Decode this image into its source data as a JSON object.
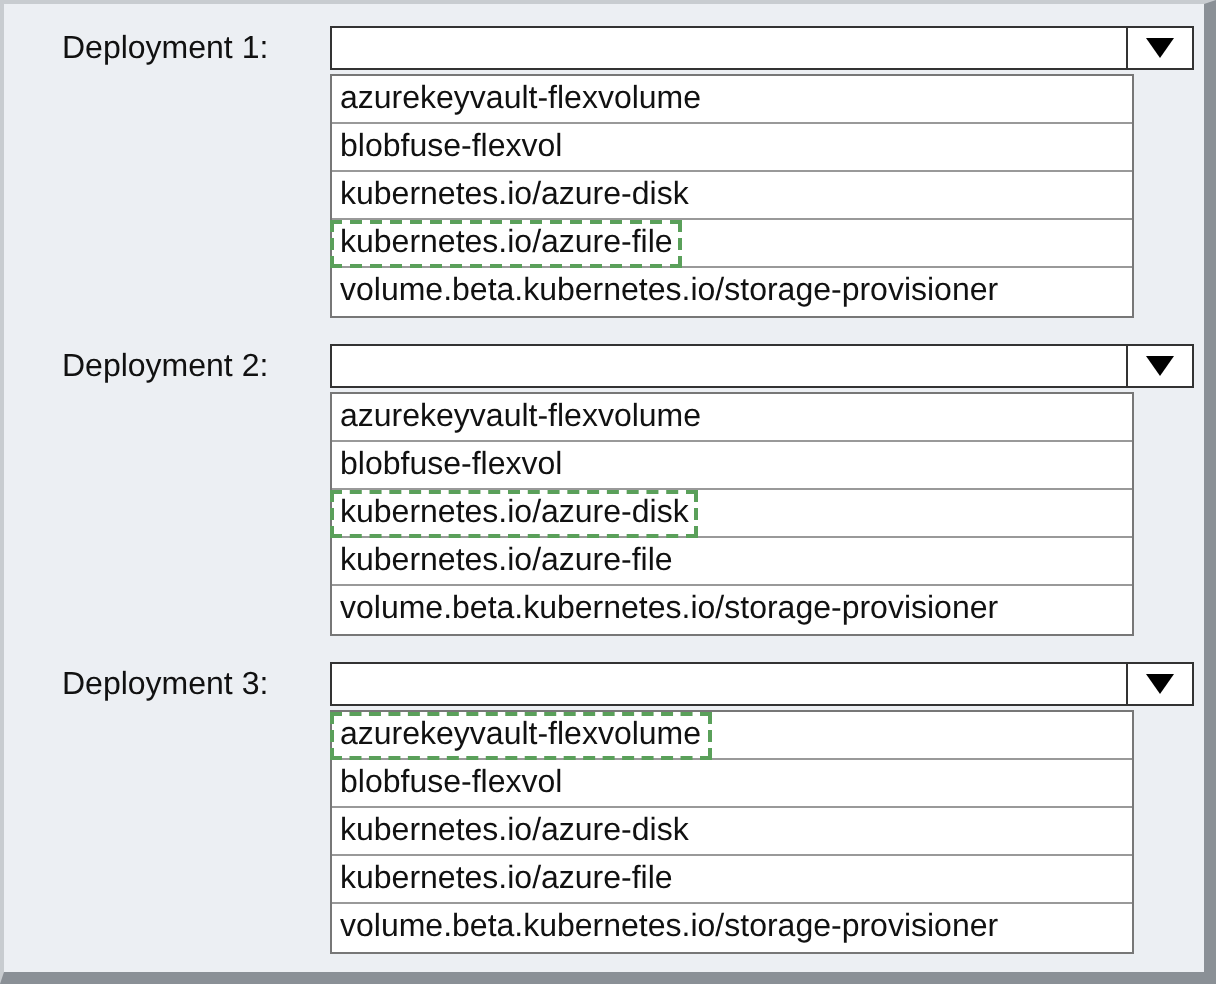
{
  "deployments": [
    {
      "label": "Deployment 1:",
      "options": [
        {
          "text": "azurekeyvault-flexvolume",
          "selected": false
        },
        {
          "text": "blobfuse-flexvol",
          "selected": false
        },
        {
          "text": "kubernetes.io/azure-disk",
          "selected": false
        },
        {
          "text": "kubernetes.io/azure-file",
          "selected": true
        },
        {
          "text": "volume.beta.kubernetes.io/storage-provisioner",
          "selected": false
        }
      ]
    },
    {
      "label": "Deployment 2:",
      "options": [
        {
          "text": "azurekeyvault-flexvolume",
          "selected": false
        },
        {
          "text": "blobfuse-flexvol",
          "selected": false
        },
        {
          "text": "kubernetes.io/azure-disk",
          "selected": true
        },
        {
          "text": "kubernetes.io/azure-file",
          "selected": false
        },
        {
          "text": "volume.beta.kubernetes.io/storage-provisioner",
          "selected": false
        }
      ]
    },
    {
      "label": "Deployment 3:",
      "options": [
        {
          "text": "azurekeyvault-flexvolume",
          "selected": true
        },
        {
          "text": "blobfuse-flexvol",
          "selected": false
        },
        {
          "text": "kubernetes.io/azure-disk",
          "selected": false
        },
        {
          "text": "kubernetes.io/azure-file",
          "selected": false
        },
        {
          "text": "volume.beta.kubernetes.io/storage-provisioner",
          "selected": false
        }
      ]
    }
  ]
}
